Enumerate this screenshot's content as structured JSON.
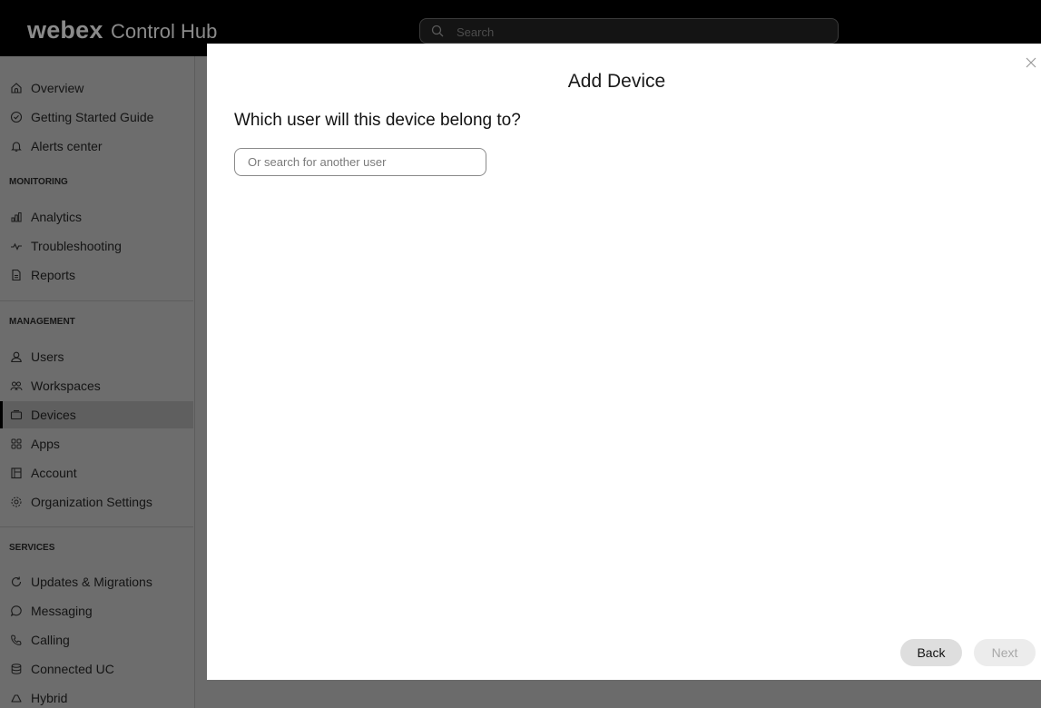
{
  "app": {
    "wordmark": "webex",
    "product": "Control Hub"
  },
  "topbar": {
    "search_placeholder": "Search"
  },
  "sidebar": {
    "group_top": [
      {
        "label": "Overview",
        "icon": "home-icon"
      },
      {
        "label": "Getting Started Guide",
        "icon": "check-circle-icon"
      },
      {
        "label": "Alerts center",
        "icon": "bell-icon"
      }
    ],
    "monitoring_header": "MONITORING",
    "monitoring": [
      {
        "label": "Analytics",
        "icon": "bar-chart-icon"
      },
      {
        "label": "Troubleshooting",
        "icon": "pulse-icon"
      },
      {
        "label": "Reports",
        "icon": "document-icon"
      }
    ],
    "management_header": "MANAGEMENT",
    "management": [
      {
        "label": "Users",
        "icon": "user-icon"
      },
      {
        "label": "Workspaces",
        "icon": "people-icon"
      },
      {
        "label": "Devices",
        "icon": "device-icon",
        "active": true
      },
      {
        "label": "Apps",
        "icon": "apps-grid-icon"
      },
      {
        "label": "Account",
        "icon": "building-icon"
      },
      {
        "label": "Organization Settings",
        "icon": "gear-icon"
      }
    ],
    "services_header": "SERVICES",
    "services": [
      {
        "label": "Updates & Migrations",
        "icon": "refresh-icon"
      },
      {
        "label": "Messaging",
        "icon": "chat-bubble-icon"
      },
      {
        "label": "Calling",
        "icon": "phone-icon"
      },
      {
        "label": "Connected UC",
        "icon": "database-icon"
      },
      {
        "label": "Hybrid",
        "icon": "cloud-icon"
      }
    ]
  },
  "modal": {
    "title": "Add Device",
    "question": "Which user will this device belong to?",
    "search_placeholder": "Or search for another user",
    "back_label": "Back",
    "next_label": "Next"
  },
  "colors": {
    "topbar_bg": "#000000",
    "sidebar_bg": "#6d6d6d",
    "modal_bg": "#ffffff",
    "back_button_bg": "#dedede",
    "next_button_bg": "#ececec"
  }
}
